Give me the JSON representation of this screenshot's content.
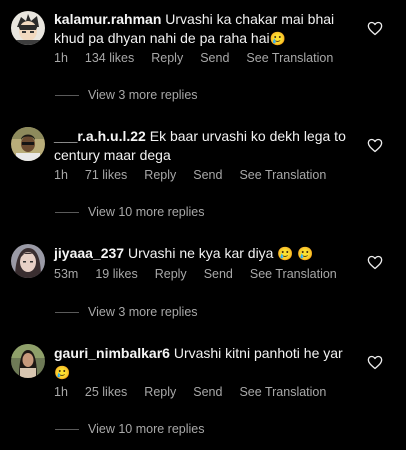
{
  "comments": [
    {
      "username": "kalamur.rahman",
      "text": "Urvashi ka chakar mai bhai khud pa dhyan nahi de pa raha hai",
      "emoji": "🥲",
      "time": "1h",
      "likes": "134 likes",
      "reply": "Reply",
      "send": "Send",
      "translate": "See Translation",
      "view_more": "View 3 more replies"
    },
    {
      "username": "___r.a.h.u.l.22",
      "text": "Ek baar urvashi ko dekh lega to century maar dega",
      "emoji": "",
      "time": "1h",
      "likes": "71 likes",
      "reply": "Reply",
      "send": "Send",
      "translate": "See Translation",
      "view_more": "View 10 more replies"
    },
    {
      "username": "jiyaaa_237",
      "text": "Urvashi ne kya kar diya",
      "emoji": "🥲 🥲",
      "time": "53m",
      "likes": "19 likes",
      "reply": "Reply",
      "send": "Send",
      "translate": "See Translation",
      "view_more": "View 3 more replies"
    },
    {
      "username": "gauri_nimbalkar6",
      "text": "Urvashi kitni panhoti he yar",
      "emoji": "🥲",
      "time": "1h",
      "likes": "25 likes",
      "reply": "Reply",
      "send": "Send",
      "translate": "See Translation",
      "view_more": "View 10 more replies"
    }
  ],
  "icons": {
    "like": "heart-outline-icon",
    "avatar": "avatar"
  },
  "colors": {
    "background": "#000000",
    "primary_text": "#f5f5f5",
    "secondary_text": "#a8a8a8"
  }
}
